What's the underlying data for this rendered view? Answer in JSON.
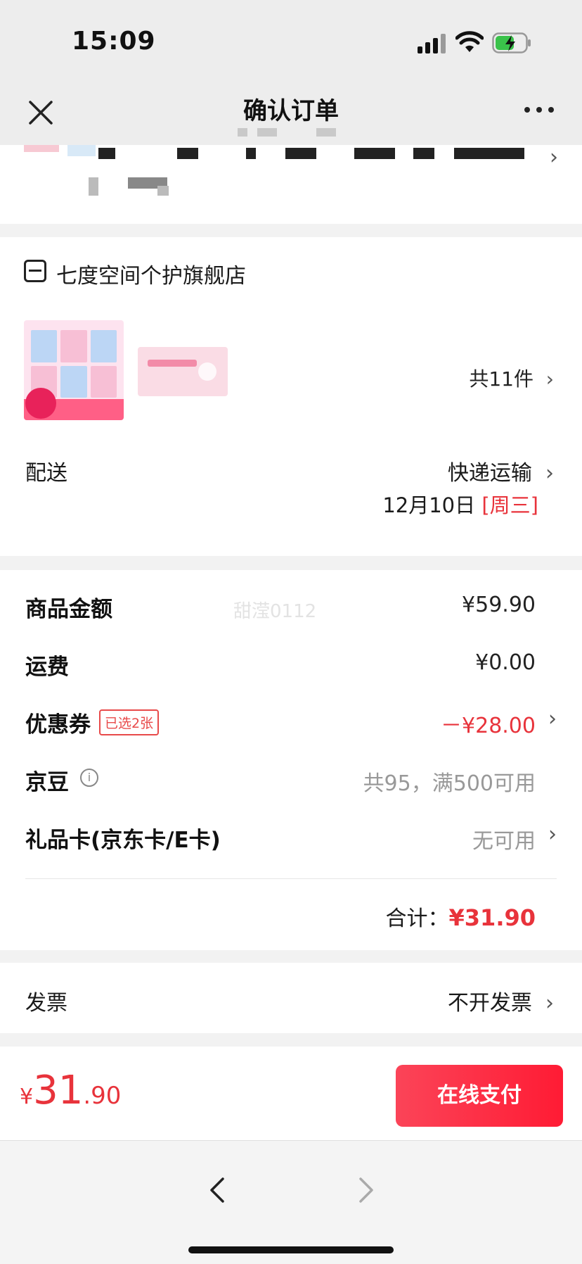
{
  "status_bar": {
    "time": "15:09"
  },
  "header": {
    "title": "确认订单"
  },
  "store": {
    "name": "七度空间个护旗舰店",
    "item_count": "共11件",
    "delivery_label": "配送",
    "delivery_method": "快递运输",
    "delivery_date": "12月10日",
    "delivery_weekday": "[周三]"
  },
  "pricing": {
    "watermark": "甜滢0112",
    "rows": [
      {
        "label": "商品金额",
        "value": "¥59.90"
      },
      {
        "label": "运费",
        "value": "¥0.00"
      },
      {
        "label": "优惠券",
        "tag": "已选2张",
        "value": "－¥28.00"
      },
      {
        "label": "京豆",
        "value": "共95，满500可用"
      },
      {
        "label": "礼品卡(京东卡/E卡)",
        "value": "无可用"
      }
    ],
    "total_label": "合计：",
    "total_value": "¥31.90"
  },
  "invoice": {
    "label": "发票",
    "value": "不开发票"
  },
  "checkout": {
    "currency": "¥",
    "amount_int": "31",
    "amount_dec": ".90",
    "pay_button": "在线支付"
  },
  "colors": {
    "accent": "#e8333b",
    "pay_button": "#ff1b34"
  }
}
